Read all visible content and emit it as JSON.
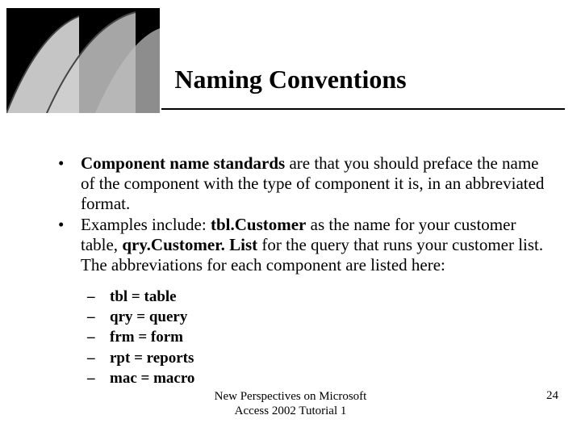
{
  "title": "Naming Conventions",
  "bullets": [
    {
      "segments": [
        {
          "text": "Component name standards",
          "bold": true
        },
        {
          "text": " are that you should preface the name of the component with the type of component it is, in an abbreviated format.",
          "bold": false
        }
      ]
    },
    {
      "segments": [
        {
          "text": "Examples include: ",
          "bold": false
        },
        {
          "text": "tbl.Customer",
          "bold": true
        },
        {
          "text": " as the name for your customer table, ",
          "bold": false
        },
        {
          "text": "qry.Customer. List",
          "bold": true
        },
        {
          "text": " for the query that runs your customer list. The abbreviations for each component are listed here:",
          "bold": false
        }
      ]
    }
  ],
  "sub_items": [
    "tbl = table",
    "qry = query",
    "frm = form",
    "rpt = reports",
    "mac = macro"
  ],
  "footer": {
    "line1": "New Perspectives on Microsoft",
    "line2": "Access 2002 Tutorial 1",
    "page": "24"
  }
}
